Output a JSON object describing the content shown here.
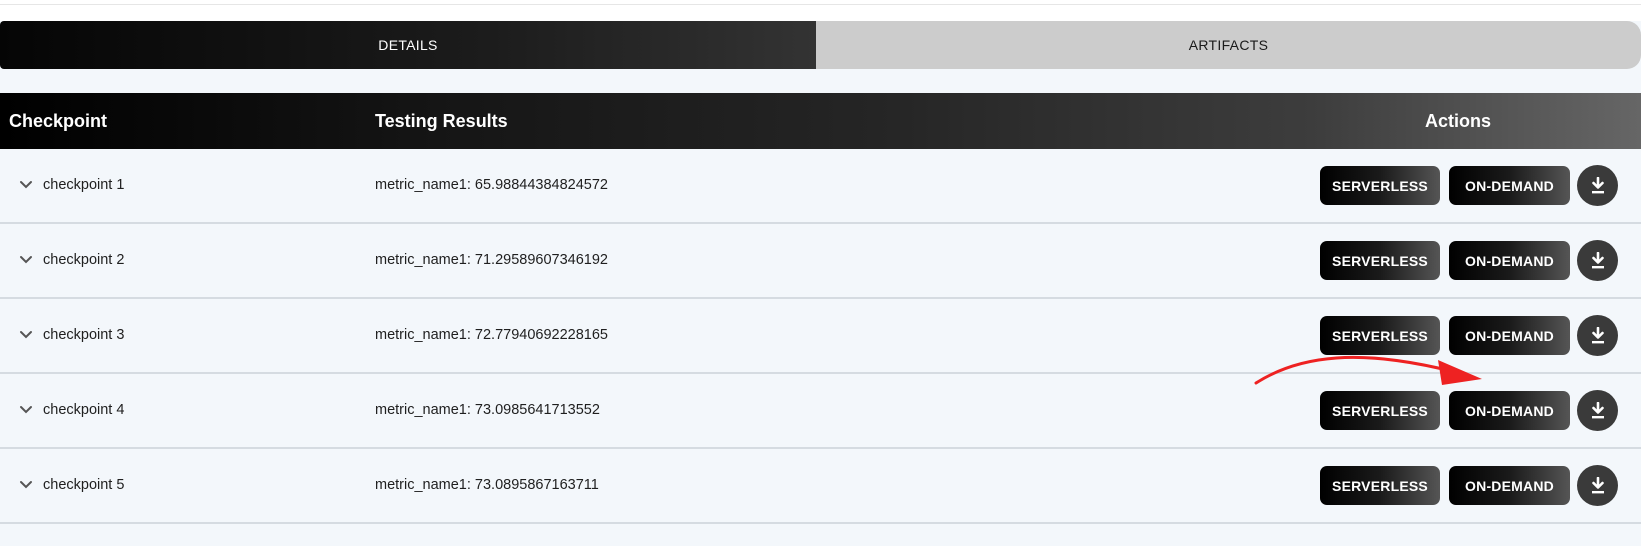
{
  "tabs": [
    {
      "label": "DETAILS",
      "active": true
    },
    {
      "label": "ARTIFACTS",
      "active": false
    }
  ],
  "table": {
    "headers": {
      "checkpoint": "Checkpoint",
      "results": "Testing Results",
      "actions": "Actions"
    },
    "rows": [
      {
        "name": "checkpoint 1",
        "metric": "metric_name1: 65.98844384824572"
      },
      {
        "name": "checkpoint 2",
        "metric": "metric_name1: 71.29589607346192"
      },
      {
        "name": "checkpoint 3",
        "metric": "metric_name1: 72.77940692228165"
      },
      {
        "name": "checkpoint 4",
        "metric": "metric_name1: 73.0985641713552"
      },
      {
        "name": "checkpoint 5",
        "metric": "metric_name1: 73.0895867163711"
      }
    ],
    "actions": {
      "serverless_label": "SERVERLESS",
      "ondemand_label": "ON-DEMAND",
      "download_icon": "download-icon",
      "expand_icon": "chevron-down-icon"
    }
  },
  "annotation": {
    "icon": "red-arrow",
    "color": "#ee2222"
  },
  "colors": {
    "background": "#f3f7fb",
    "inactive_tab": "#cccccc",
    "annotation": "#ee2222"
  }
}
